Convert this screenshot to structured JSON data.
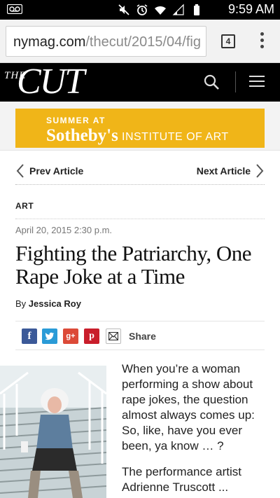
{
  "status_bar": {
    "time": "9:59 AM",
    "icons": [
      "voicemail-icon",
      "mute-icon",
      "alarm-icon",
      "wifi-icon",
      "signal-icon",
      "battery-icon"
    ]
  },
  "browser": {
    "url_host": "nymag.com",
    "url_path": "/thecut/2015/04/fig",
    "tab_count": "4"
  },
  "site": {
    "logo_the": "THE",
    "logo_cut": "CUT"
  },
  "ad": {
    "line1": "SUMMER AT",
    "brand": "Sotheby's",
    "institute": "INSTITUTE OF ART",
    "color": "#f0b518"
  },
  "nav": {
    "prev_label": "Prev Article",
    "next_label": "Next Article"
  },
  "article": {
    "section": "ART",
    "date": "April 20, 2015 2:30 p.m.",
    "headline": "Fighting the Patriarchy, One Rape Joke at a Time",
    "by_prefix": "By",
    "author": "Jessica Roy",
    "paragraphs": [
      "When you’re a woman performing a show about rape jokes, the question almost always comes up: So, like, have you ever been, ya know … ?",
      "The performance artist Adrienne Truscott ... "
    ]
  },
  "share": {
    "label": "Share",
    "buttons": [
      "facebook-icon",
      "twitter-icon",
      "google-plus-icon",
      "pinterest-icon",
      "email-icon"
    ]
  }
}
